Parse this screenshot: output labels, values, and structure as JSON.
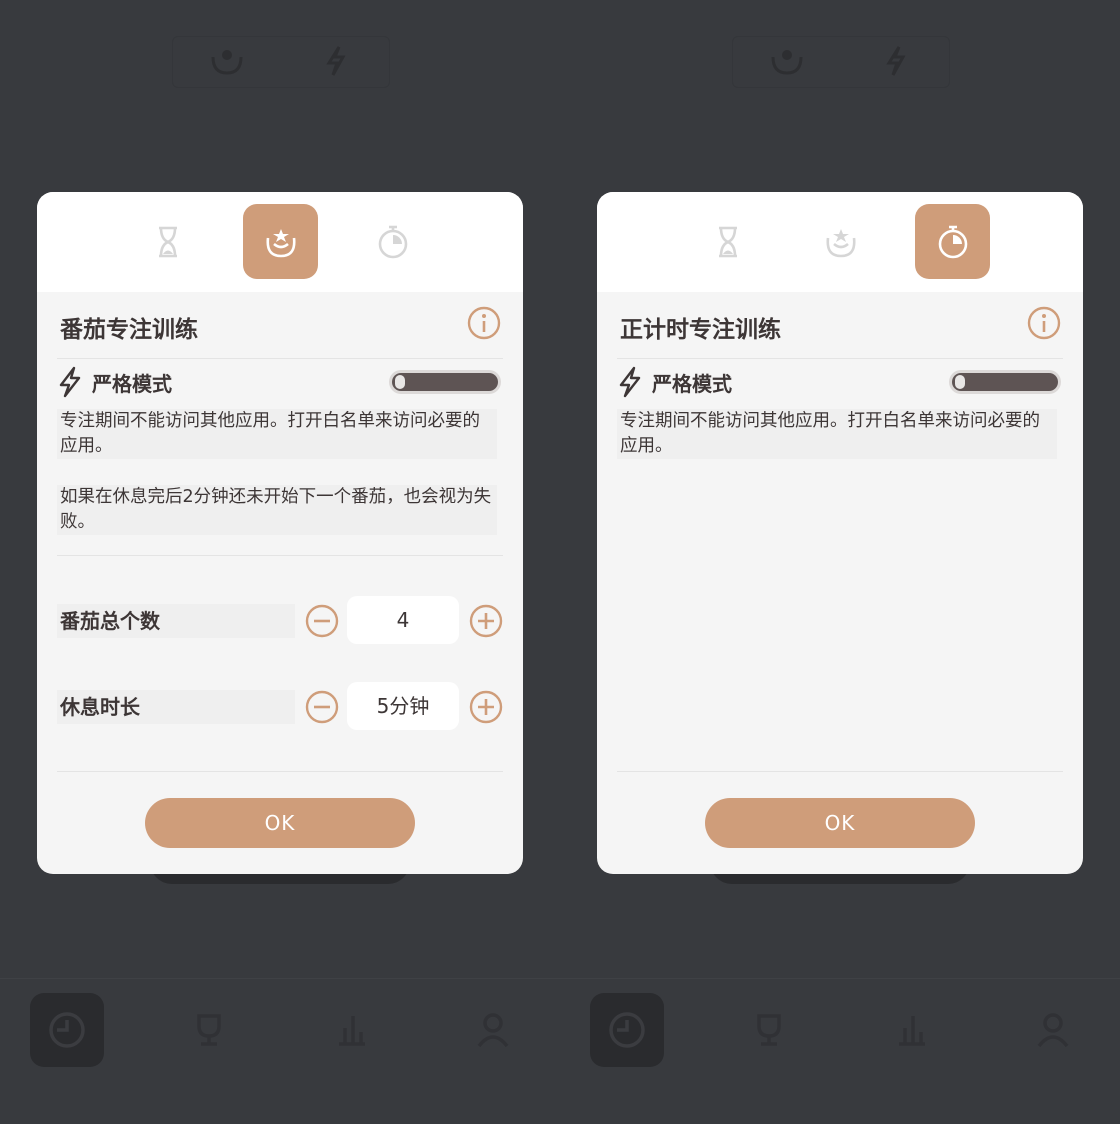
{
  "colors": {
    "accent": "#cf9d7a",
    "backdrop": "#383a3e",
    "dialog": "#f5f5f5",
    "text": "#3d3636",
    "toggle_track": "#5e5454"
  },
  "icons": {
    "tab_timer": "hourglass-icon",
    "tab_pomodoro": "tomato-icon",
    "tab_stopwatch": "stopwatch-icon",
    "info": "info-icon",
    "strict": "lightning-icon",
    "minus": "minus-circle-icon",
    "plus": "plus-circle-icon"
  },
  "left": {
    "title": "番茄专注训练",
    "strict_label": "严格模式",
    "strict_enabled": false,
    "desc1": "专注期间不能访问其他应用。打开白名单来访问必要的应用。",
    "desc2": "如果在休息完后2分钟还未开始下一个番茄，也会视为失败。",
    "count_label": "番茄总个数",
    "count_value": "4",
    "break_label": "休息时长",
    "break_value": "5分钟",
    "ok_label": "OK"
  },
  "right": {
    "title": "正计时专注训练",
    "strict_label": "严格模式",
    "strict_enabled": false,
    "desc1": "专注期间不能访问其他应用。打开白名单来访问必要的应用。",
    "ok_label": "OK"
  }
}
